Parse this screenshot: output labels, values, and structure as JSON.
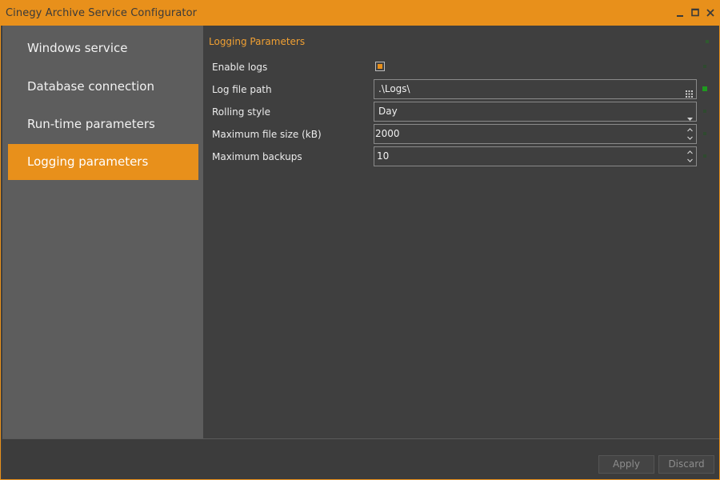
{
  "window": {
    "title": "Cinegy Archive Service Configurator"
  },
  "colors": {
    "accent": "#e8901b",
    "sidebar_bg": "#5d5d5d",
    "content_bg": "#3f3f3f",
    "indicator_active": "#1f9a1f"
  },
  "sidebar": {
    "items": [
      {
        "label": "Windows service",
        "active": false
      },
      {
        "label": "Database connection",
        "active": false
      },
      {
        "label": "Run-time parameters",
        "active": false
      },
      {
        "label": "Logging parameters",
        "active": true
      }
    ]
  },
  "section": {
    "title": "Logging Parameters"
  },
  "fields": {
    "enable_logs": {
      "label": "Enable logs",
      "checked": true
    },
    "log_file_path": {
      "label": "Log file path",
      "value": ".\\Logs\\",
      "icon": "browse-grid-icon"
    },
    "rolling_style": {
      "label": "Rolling style",
      "value": "Day",
      "icon": "chevron-down-icon"
    },
    "max_file_size": {
      "label": "Maximum file size (kB)",
      "value": "2000",
      "icon": "spinner-icon"
    },
    "max_backups": {
      "label": "Maximum backups",
      "value": "10",
      "icon": "spinner-icon"
    }
  },
  "footer": {
    "apply_label": "Apply",
    "discard_label": "Discard"
  }
}
